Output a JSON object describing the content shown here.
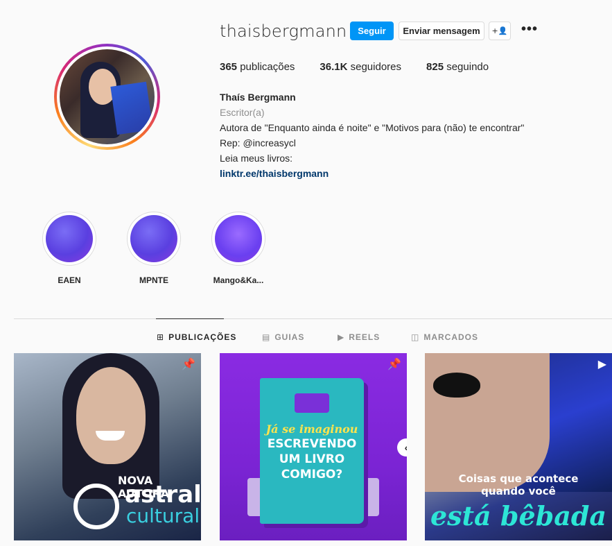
{
  "profile": {
    "username": "thaisbergmann",
    "follow_label": "Seguir",
    "message_label": "Enviar mensagem",
    "suggest_icon": "+👤",
    "more_icon": "•••",
    "stats": {
      "posts_count": "365",
      "posts_label": "publicações",
      "followers_count": "36.1K",
      "followers_label": "seguidores",
      "following_count": "825",
      "following_label": "seguindo"
    },
    "bio": {
      "name": "Thaís Bergmann",
      "category": "Escritor(a)",
      "line1": "Autora de \"Enquanto ainda é noite\" e \"Motivos para (não) te encontrar\"",
      "line2": "Rep: @increasycl",
      "line3": "Leia meus livros:",
      "link": "linktr.ee/thaisbergmann"
    }
  },
  "highlights": [
    {
      "label": "EAEN"
    },
    {
      "label": "MPNTE"
    },
    {
      "label": "Mango&Ka..."
    }
  ],
  "tabs": [
    {
      "label": "PUBLICAÇÕES",
      "icon": "⊞"
    },
    {
      "label": "GUIAS",
      "icon": "▤"
    },
    {
      "label": "REELS",
      "icon": "▶"
    },
    {
      "label": "MARCADOS",
      "icon": "◫"
    }
  ],
  "posts": {
    "p1": {
      "headline": "NOVA AUTORA",
      "brand_top": "astral",
      "brand_bottom": "cultural"
    },
    "p2": {
      "kicker": "Já se imaginou",
      "headline_1": "ESCREVENDO",
      "headline_2": "UM LIVRO",
      "headline_3": "COMIGO?"
    },
    "p3": {
      "line_1": "Coisas que acontece",
      "line_2": "quando você",
      "accent": "está bêbada"
    }
  },
  "colors": {
    "primary_button": "#0095f6",
    "link": "#00376b",
    "muted": "#8e8e8e"
  }
}
